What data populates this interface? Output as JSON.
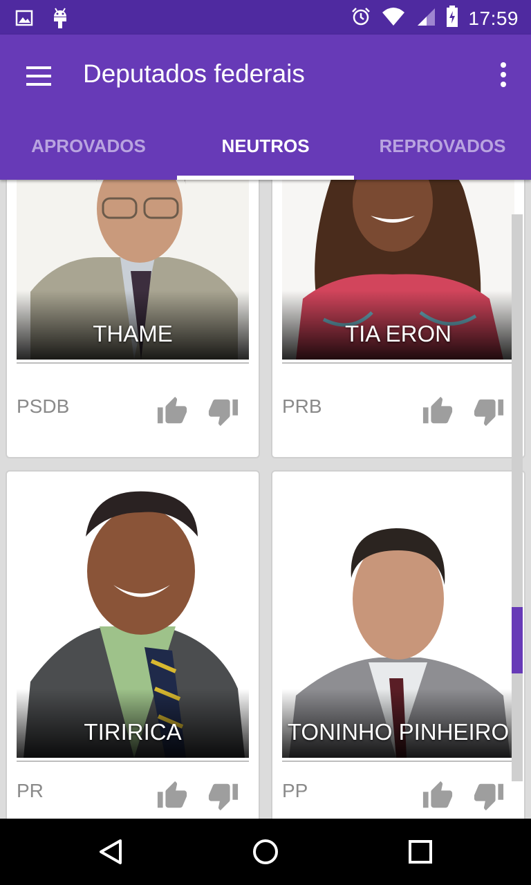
{
  "status_bar": {
    "time": "17:59"
  },
  "app_bar": {
    "title": "Deputados federais"
  },
  "tabs": [
    {
      "label": "APROVADOS",
      "active": false
    },
    {
      "label": "NEUTROS",
      "active": true
    },
    {
      "label": "REPROVADOS",
      "active": false
    }
  ],
  "cards": [
    {
      "name": "THAME",
      "party": "PSDB"
    },
    {
      "name": "TIA ERON",
      "party": "PRB"
    },
    {
      "name": "TIRIRICA",
      "party": "PR"
    },
    {
      "name": "TONINHO PINHEIRO",
      "party": "PP"
    }
  ],
  "colors": {
    "primary": "#673ab7",
    "primary_dark": "#4f2aa0",
    "inactive_tab": "#b9a4e0"
  },
  "icons": [
    "image-icon",
    "android-icon",
    "alarm-icon",
    "wifi-icon",
    "signal-icon",
    "battery-charging-icon",
    "hamburger-menu-icon",
    "more-vert-icon",
    "thumb-up-icon",
    "thumb-down-icon",
    "back-icon",
    "home-icon",
    "recents-icon"
  ]
}
